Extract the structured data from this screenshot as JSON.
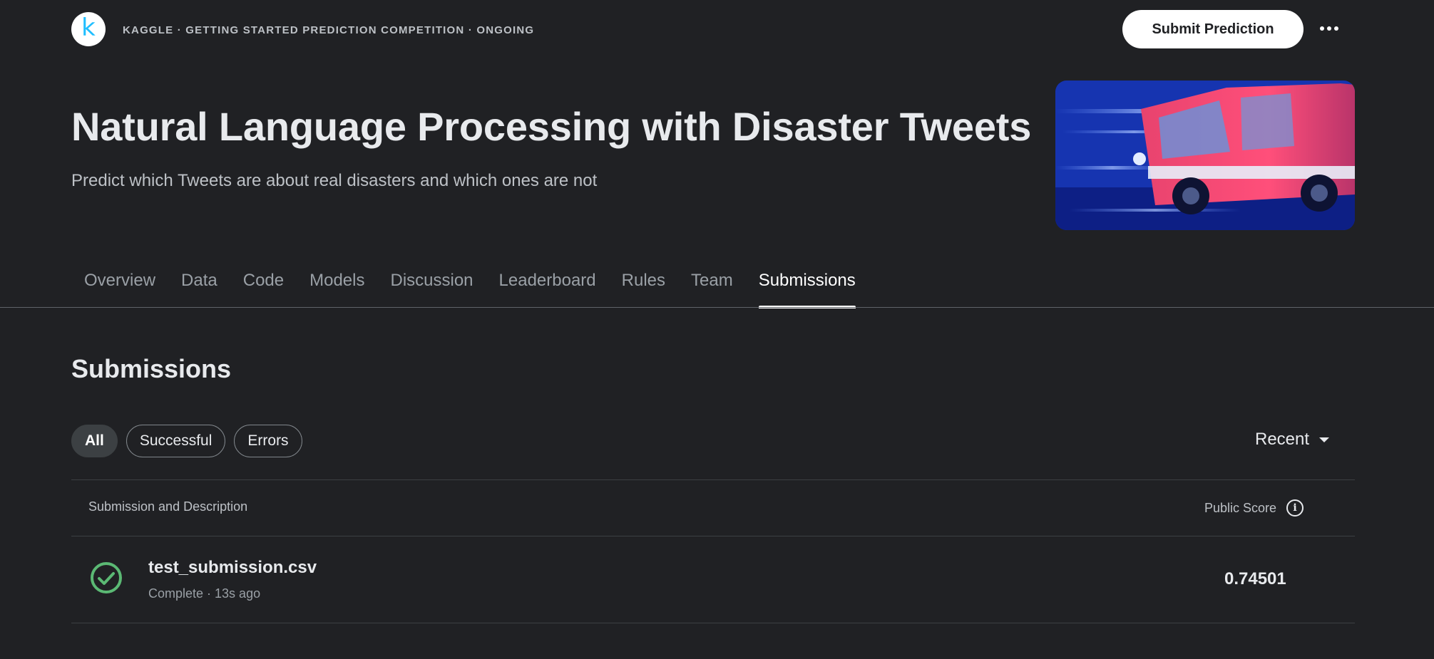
{
  "header": {
    "logo_letter": "k",
    "breadcrumb": "KAGGLE · GETTING STARTED PREDICTION COMPETITION · ONGOING",
    "submit_label": "Submit Prediction",
    "more_icon": "more-horizontal-icon"
  },
  "competition": {
    "title": "Natural Language Processing with Disaster Tweets",
    "subtitle": "Predict which Tweets are about real disasters and which ones are not"
  },
  "tabs": [
    {
      "label": "Overview",
      "active": false
    },
    {
      "label": "Data",
      "active": false
    },
    {
      "label": "Code",
      "active": false
    },
    {
      "label": "Models",
      "active": false
    },
    {
      "label": "Discussion",
      "active": false
    },
    {
      "label": "Leaderboard",
      "active": false
    },
    {
      "label": "Rules",
      "active": false
    },
    {
      "label": "Team",
      "active": false
    },
    {
      "label": "Submissions",
      "active": true
    }
  ],
  "submissions": {
    "title": "Submissions",
    "filters": [
      {
        "label": "All",
        "active": true
      },
      {
        "label": "Successful",
        "active": false
      },
      {
        "label": "Errors",
        "active": false
      }
    ],
    "sort_label": "Recent",
    "columns": {
      "left": "Submission and Description",
      "right": "Public Score"
    },
    "rows": [
      {
        "file": "test_submission.csv",
        "meta": "Complete · 13s ago",
        "score": "0.74501",
        "status_icon": "check-circle-icon"
      }
    ]
  },
  "colors": {
    "background": "#202124",
    "success": "#5bb974",
    "accent": "#20beff"
  }
}
